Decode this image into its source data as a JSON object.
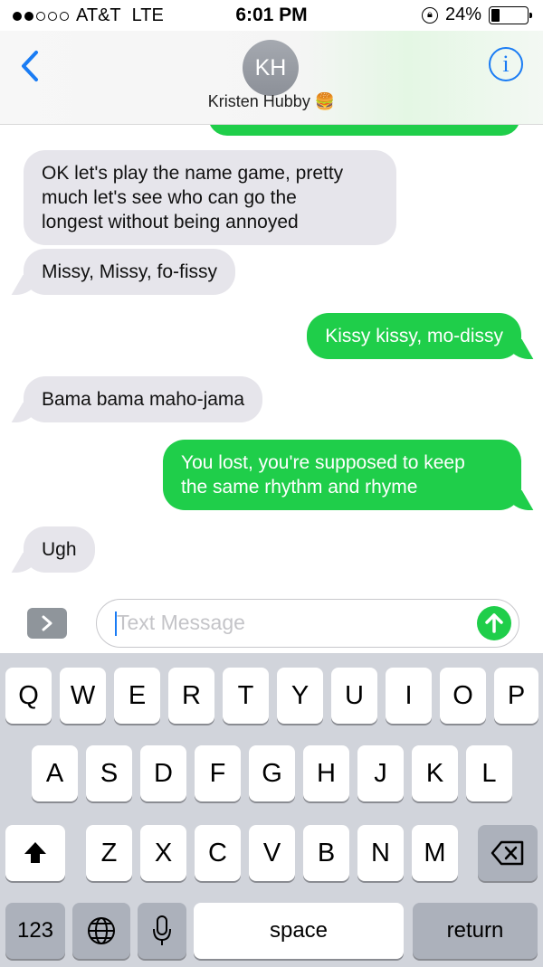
{
  "status_bar": {
    "carrier": "AT&T",
    "network": "LTE",
    "time": "6:01 PM",
    "battery": "24%",
    "signal_bars_filled": 2,
    "signal_bars_total": 5,
    "battery_level": 0.24
  },
  "header": {
    "avatar_initials": "KH",
    "contact_name": "Kristen Hubby 🍔"
  },
  "messages": [
    {
      "from": "them",
      "text_lines": [
        "OK let's play the name game, pretty",
        "much let's see who can go the",
        "longest without being annoyed"
      ]
    },
    {
      "from": "them",
      "text_lines": [
        "Missy, Missy, fo-fissy"
      ]
    },
    {
      "from": "me",
      "text_lines": [
        "Kissy kissy, mo-dissy"
      ]
    },
    {
      "from": "them",
      "text_lines": [
        "Bama bama maho-jama"
      ]
    },
    {
      "from": "me",
      "text_lines": [
        "You lost, you're supposed to keep",
        "the same rhythm and rhyme"
      ]
    },
    {
      "from": "them",
      "text_lines": [
        "Ugh"
      ]
    }
  ],
  "compose": {
    "placeholder": "Text Message"
  },
  "keyboard": {
    "row1": [
      "Q",
      "W",
      "E",
      "R",
      "T",
      "Y",
      "U",
      "I",
      "O",
      "P"
    ],
    "row2": [
      "A",
      "S",
      "D",
      "F",
      "G",
      "H",
      "J",
      "K",
      "L"
    ],
    "row3": [
      "Z",
      "X",
      "C",
      "V",
      "B",
      "N",
      "M"
    ],
    "numbers_key": "123",
    "space_key": "space",
    "return_key": "return"
  },
  "colors": {
    "incoming_bubble": "#e6e5eb",
    "outgoing_bubble": "#1fce4a",
    "accent_blue": "#1a7cf4",
    "keyboard_bg": "#d1d4db"
  },
  "icons": [
    "back-chevron-icon",
    "info-icon",
    "expand-arrow-icon",
    "send-arrow-icon",
    "shift-icon",
    "globe-icon",
    "microphone-icon",
    "backspace-icon",
    "rotation-lock-icon"
  ]
}
